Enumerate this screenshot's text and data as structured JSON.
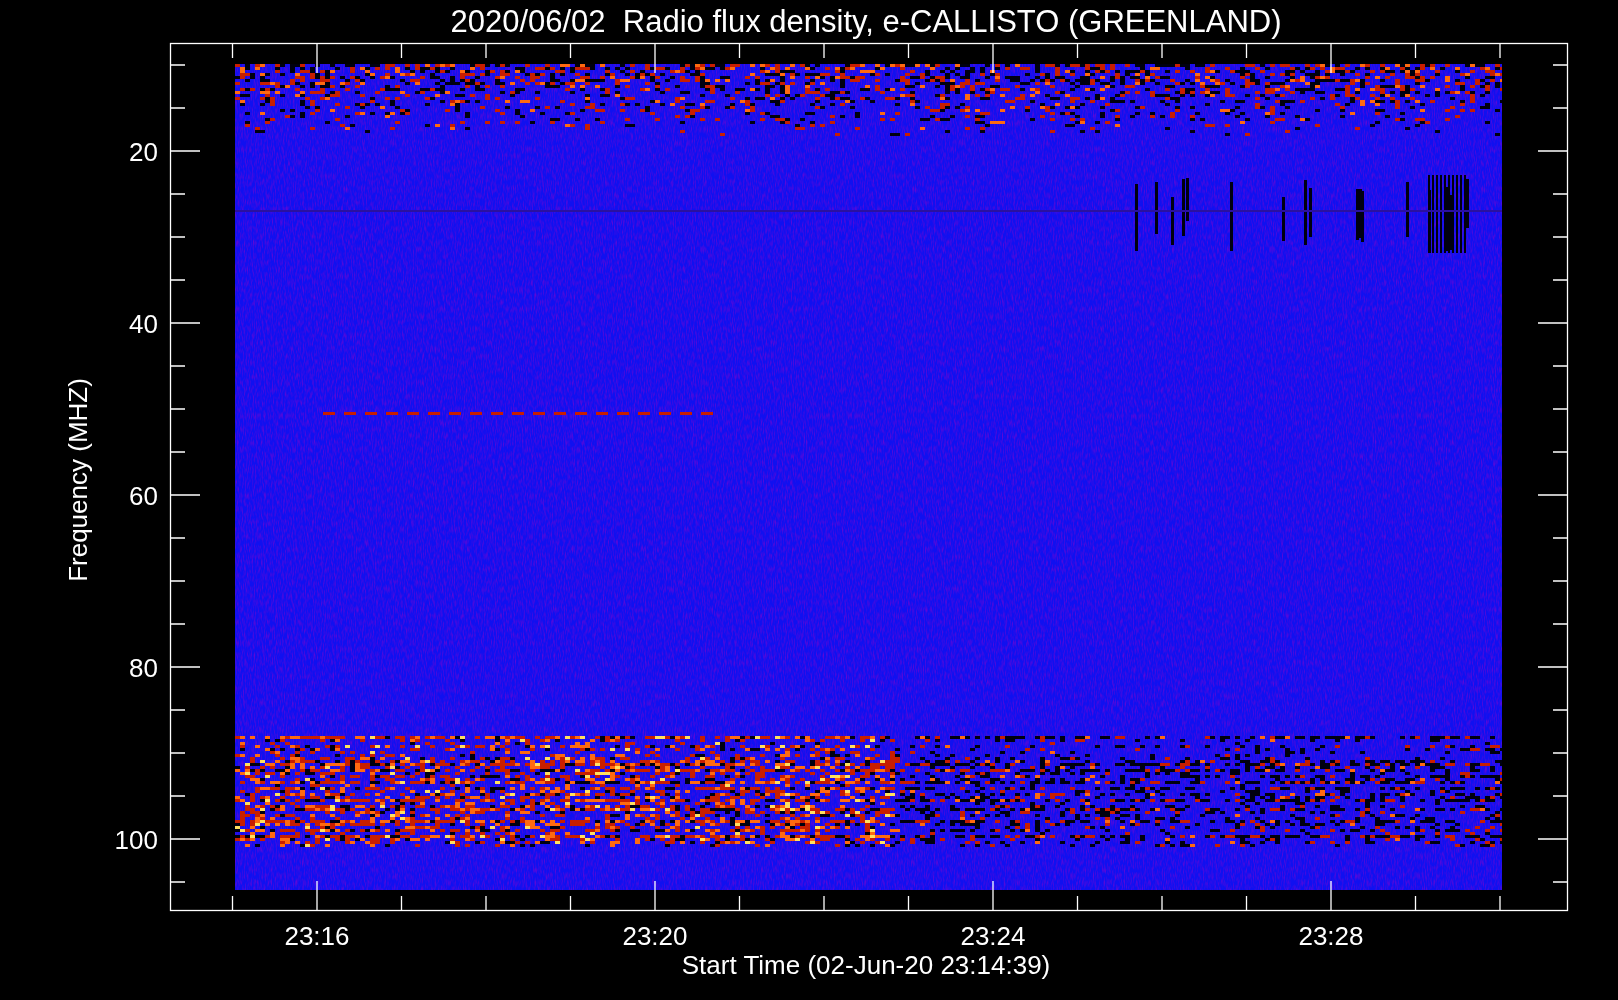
{
  "title": "2020/06/02  Radio flux density, e-CALLISTO (GREENLAND)",
  "ylabel": "Frequency (MHZ)",
  "xlabel": "Start Time (02-Jun-20 23:14:39)",
  "yticks": [
    "20",
    "40",
    "60",
    "80",
    "100"
  ],
  "xticks": [
    "23:16",
    "23:20",
    "23:24",
    "23:28"
  ]
}
